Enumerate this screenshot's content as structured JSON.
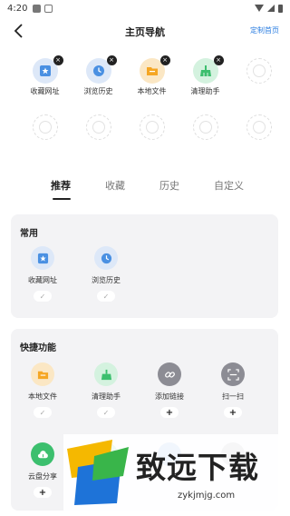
{
  "status_bar": {
    "time": "4:20"
  },
  "header": {
    "title": "主页导航",
    "customize_label": "定制首页"
  },
  "top_nav": {
    "items": [
      {
        "label": "收藏网址",
        "icon": "bookmark-icon",
        "color": "#4a90e2"
      },
      {
        "label": "浏览历史",
        "icon": "clock-icon",
        "color": "#4a90e2"
      },
      {
        "label": "本地文件",
        "icon": "folder-icon",
        "color": "#f5a623"
      },
      {
        "label": "清理助手",
        "icon": "broom-icon",
        "color": "#3cbf6e"
      }
    ],
    "remove_glyph": "×"
  },
  "tabs": [
    {
      "label": "推荐",
      "active": true
    },
    {
      "label": "收藏",
      "active": false
    },
    {
      "label": "历史",
      "active": false
    },
    {
      "label": "自定义",
      "active": false
    }
  ],
  "card_common": {
    "title": "常用",
    "items": [
      {
        "label": "收藏网址",
        "icon": "bookmark-icon",
        "color": "#4a90e2",
        "state": "✓"
      },
      {
        "label": "浏览历史",
        "icon": "clock-icon",
        "color": "#4a90e2",
        "state": "✓"
      }
    ]
  },
  "card_quick": {
    "title": "快捷功能",
    "items": [
      {
        "label": "本地文件",
        "icon": "folder-icon",
        "color": "#f5a623",
        "state": "✓"
      },
      {
        "label": "清理助手",
        "icon": "broom-icon",
        "color": "#3cbf6e",
        "state": "✓"
      },
      {
        "label": "添加链接",
        "icon": "link-icon",
        "color": "#8c8c94",
        "state": "+"
      },
      {
        "label": "扫一扫",
        "icon": "scan-icon",
        "color": "#8c8c94",
        "state": "+"
      },
      {
        "label": "云盘分享",
        "icon": "cloud-icon",
        "color": "#3cbf6e",
        "state": "+"
      }
    ]
  },
  "watermark": {
    "text": "致远下载",
    "url": "zykjmjg.com"
  }
}
